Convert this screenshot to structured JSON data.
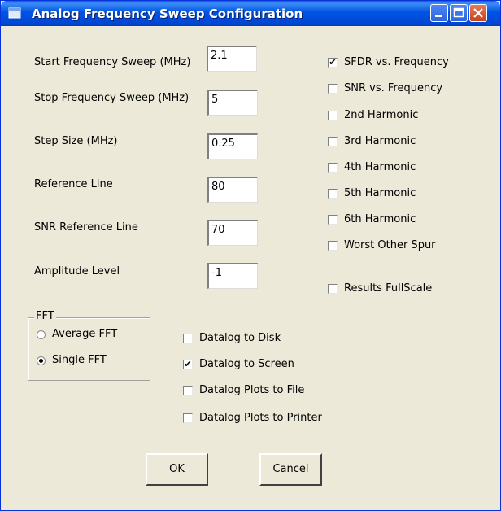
{
  "window": {
    "title": "Analog Frequency Sweep Configuration",
    "icon": "app-icon"
  },
  "title_buttons": {
    "minimize": "minimize-icon",
    "maximize": "maximize-icon",
    "close": "close-icon"
  },
  "fields": [
    {
      "label": "Start Frequency Sweep (MHz)",
      "value": "2.1"
    },
    {
      "label": "Stop Frequency Sweep (MHz)",
      "value": "5"
    },
    {
      "label": "Step Size (MHz)",
      "value": "0.25"
    },
    {
      "label": "Reference Line",
      "value": "80"
    },
    {
      "label": "SNR Reference Line",
      "value": "70"
    },
    {
      "label": "Amplitude Level",
      "value": "-1"
    }
  ],
  "plots": [
    {
      "label": "SFDR vs. Frequency",
      "checked": true
    },
    {
      "label": "SNR vs. Frequency",
      "checked": false
    },
    {
      "label": "2nd Harmonic",
      "checked": false
    },
    {
      "label": "3rd Harmonic",
      "checked": false
    },
    {
      "label": "4th Harmonic",
      "checked": false
    },
    {
      "label": "5th Harmonic",
      "checked": false
    },
    {
      "label": "6th Harmonic",
      "checked": false
    },
    {
      "label": "Worst Other Spur",
      "checked": false
    }
  ],
  "results_fullscale": {
    "label": "Results FullScale",
    "checked": false
  },
  "fft": {
    "title": "FFT",
    "options": [
      {
        "label": "Average FFT",
        "selected": false
      },
      {
        "label": "Single FFT",
        "selected": true
      }
    ]
  },
  "datalog": [
    {
      "label": "Datalog to Disk",
      "checked": false
    },
    {
      "label": "Datalog to Screen",
      "checked": true
    },
    {
      "label": "Datalog Plots to File",
      "checked": false
    },
    {
      "label": "Datalog Plots to Printer",
      "checked": false
    }
  ],
  "buttons": {
    "ok": "OK",
    "cancel": "Cancel"
  },
  "check_mark": "✔"
}
